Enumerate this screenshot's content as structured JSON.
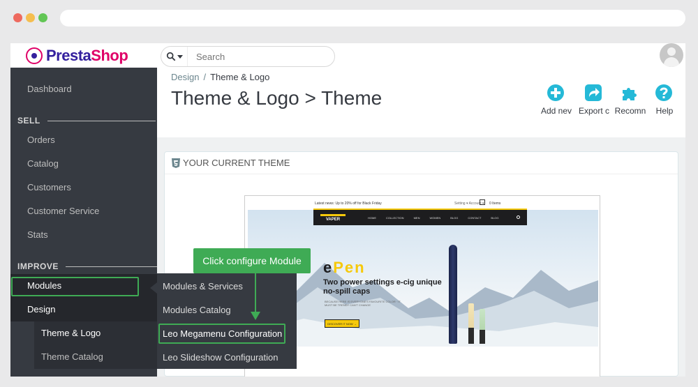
{
  "browser": {},
  "header": {
    "logo_part1": "Presta",
    "logo_part2": "Shop",
    "search_placeholder": "Search"
  },
  "sidebar": {
    "dashboard": "Dashboard",
    "sell_title": "SELL",
    "sell_items": [
      "Orders",
      "Catalog",
      "Customers",
      "Customer Service",
      "Stats"
    ],
    "improve_title": "IMPROVE",
    "modules": "Modules",
    "design": "Design",
    "design_sub": [
      "Theme & Logo",
      "Theme Catalog"
    ]
  },
  "flyout": {
    "items": [
      "Modules & Services",
      "Modules Catalog",
      "Leo Megamenu Configuration",
      "Leo Slideshow Configuration"
    ]
  },
  "callout": {
    "text": "Click configure Module",
    "color": "#3fab55"
  },
  "main": {
    "breadcrumb": [
      "Design",
      "/",
      "Theme & Logo"
    ],
    "title": "Theme & Logo > Theme",
    "toolbar": [
      {
        "label": "Add nev",
        "icon": "plus-circle-icon"
      },
      {
        "label": "Export c",
        "icon": "share-icon"
      },
      {
        "label": "Recomn",
        "icon": "puzzle-icon"
      },
      {
        "label": "Help",
        "icon": "help-icon"
      }
    ],
    "accent": "#25b9d7",
    "panel_title": "YOUR CURRENT THEME"
  },
  "preview": {
    "latest": "Latest news: Up to 20% off for Black Friday",
    "account": "Setting ▾   Account ▾",
    "items": "0 Items",
    "logo": "VAPER",
    "menu": [
      "HOME",
      "COLLECTION",
      "MEN",
      "WOMEN",
      "BLOG",
      "CONTACT",
      "BLOG"
    ],
    "brand1": "e",
    "brand2": "Pen",
    "tagline": "Two power settings e-cig unique no-spill caps",
    "small": "BECAUSE HERE IS EVERYONE'S FAVOURITE COLOR · IT MUST BE TRENDY CAN'T CHANGE",
    "button": "DISCOVER IT NOW →"
  }
}
